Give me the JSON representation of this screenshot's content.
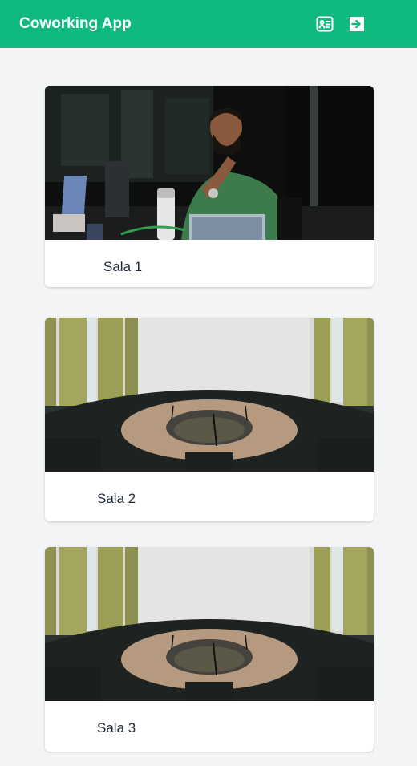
{
  "app": {
    "title": "Coworking App",
    "brand_color": "#10b981"
  },
  "header_icons": {
    "bookings": "id-card-icon",
    "logout": "sign-in-arrow-icon"
  },
  "rooms": [
    {
      "name": "Sala 1",
      "photo": "person-working-laptop-photo"
    },
    {
      "name": "Sala 2",
      "photo": "conference-room-oval-table-photo"
    },
    {
      "name": "Sala 3",
      "photo": "conference-room-oval-table-photo"
    }
  ]
}
